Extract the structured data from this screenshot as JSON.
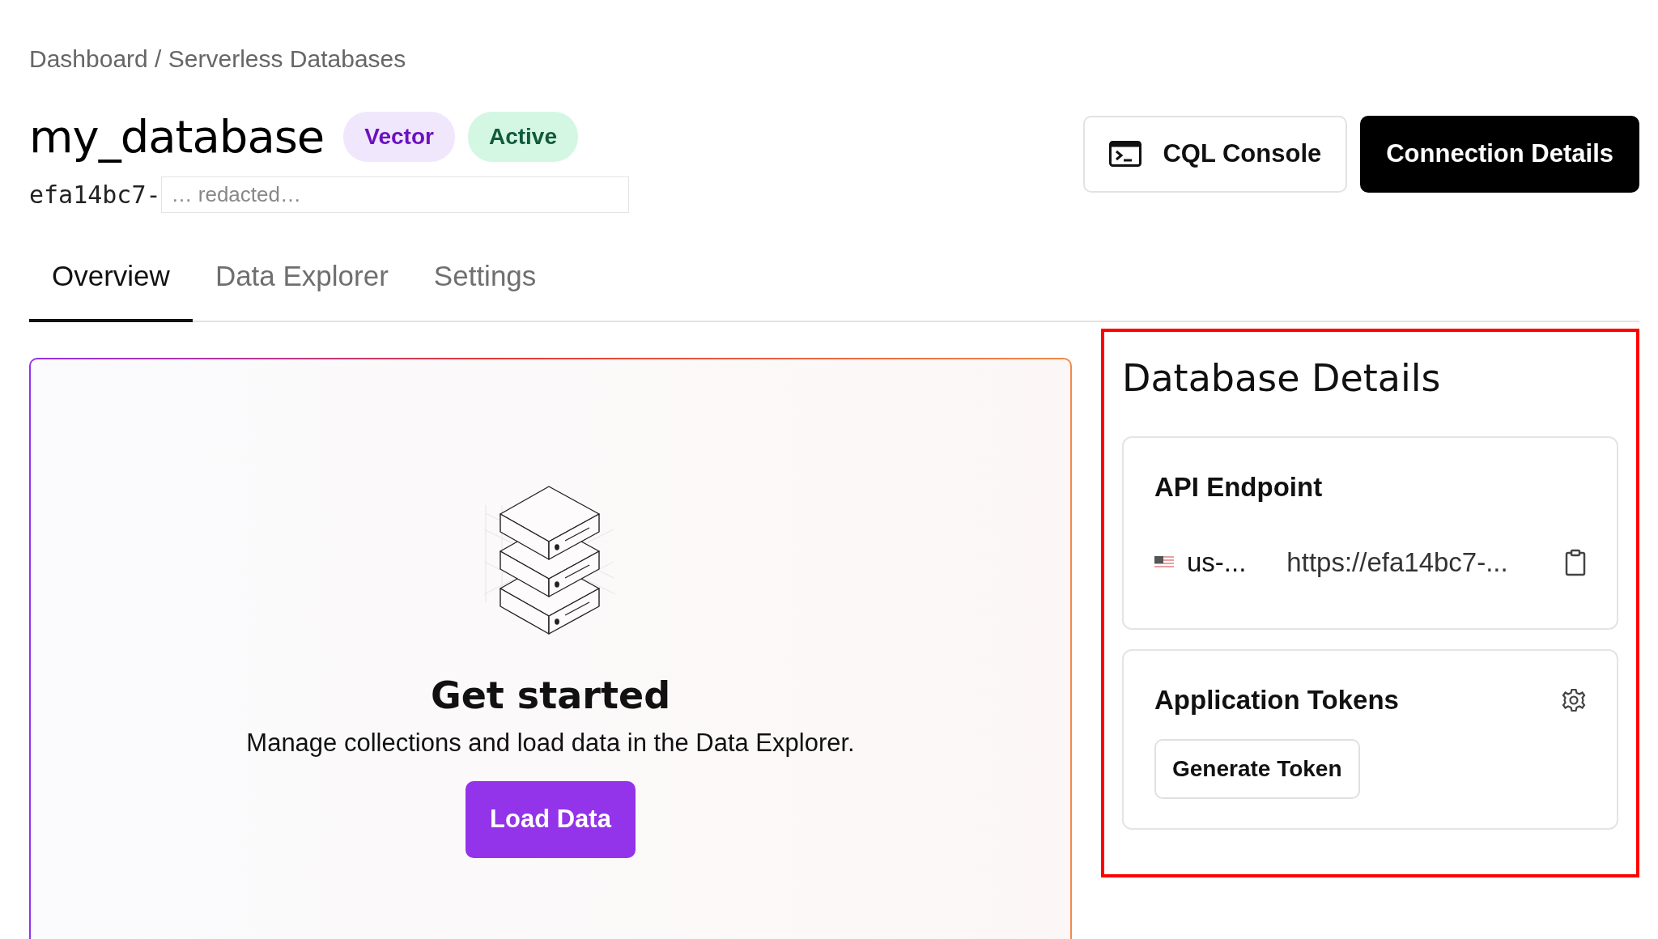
{
  "breadcrumb": {
    "link": "Dashboard",
    "separator": "/",
    "current": "Serverless Databases"
  },
  "database": {
    "name": "my_database",
    "badges": [
      {
        "label": "Vector",
        "kind": "type"
      },
      {
        "label": "Active",
        "kind": "status"
      }
    ],
    "id": {
      "prefix": "efa14bc7-",
      "redacted": "… redacted…"
    }
  },
  "actions": [
    {
      "label": "CQL Console",
      "kind": "console"
    },
    {
      "label": "Connection Details",
      "kind": "primary"
    }
  ],
  "tabs": [
    {
      "label": "Overview",
      "selected": true
    },
    {
      "label": "Data Explorer",
      "selected": false
    },
    {
      "label": "Settings",
      "selected": false
    }
  ],
  "get_started": {
    "title": "Get started",
    "text": "Manage collections and load data in the Data Explorer.",
    "button": "Load Data"
  },
  "details": {
    "title": "Database Details",
    "api_endpoint": {
      "title": "API Endpoint",
      "region": "us-...",
      "url": "https://efa14bc7-..."
    },
    "tokens": {
      "title": "Application Tokens",
      "button": "Generate Token"
    }
  }
}
